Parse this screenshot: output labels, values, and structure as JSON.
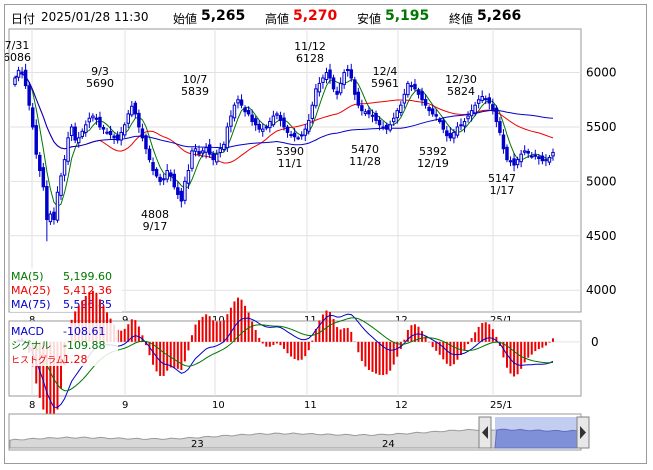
{
  "header": {
    "date_label": "日付",
    "datetime": "2025/01/28 11:30",
    "open_label": "始値",
    "open": "5,265",
    "high_label": "高値",
    "high": "5,270",
    "low_label": "安値",
    "low": "5,195",
    "close_label": "終値",
    "close": "5,266"
  },
  "colors": {
    "up": "#0000cc",
    "down": "#0000cc",
    "ma5": "#007700",
    "ma25": "#ee0000",
    "ma75": "#0000cc",
    "hist_pos": "#ee0000",
    "hist_neg": "#ee0000",
    "high_text": "#ee0000",
    "low_text": "#007700"
  },
  "legend": {
    "ma5_label": "MA(5)",
    "ma5_value": "5,199.60",
    "ma25_label": "MA(25)",
    "ma25_value": "5,412.36",
    "ma75_label": "MA(75)",
    "ma75_value": "5,596.85"
  },
  "macd_legend": {
    "macd_label": "MACD",
    "macd_value": "-108.61",
    "signal_label": "シグナル",
    "signal_value": "-109.88",
    "hist_label": "ヒストグラム",
    "hist_value": "1.28"
  },
  "chart_data": [
    {
      "type": "candlestick",
      "ylim": [
        3800,
        6400
      ],
      "y_ticks": [
        4000,
        4500,
        5000,
        5500,
        6000
      ],
      "x_ticks": [
        "8",
        "9",
        "10",
        "11",
        "12",
        "25/1"
      ],
      "annotations": [
        {
          "value": "7/31",
          "price": "6086"
        },
        {
          "value": "9/3",
          "price": "5690"
        },
        {
          "value": "10/7",
          "price": "5839"
        },
        {
          "value": "11/12",
          "price": "6128"
        },
        {
          "value": "12/4",
          "price": "5961"
        },
        {
          "value": "12/30",
          "price": "5824"
        },
        {
          "price": "4808",
          "value": "9/17"
        },
        {
          "price": "5390",
          "value": "11/1"
        },
        {
          "price": "5470",
          "value": "11/28"
        },
        {
          "price": "5392",
          "value": "12/19"
        },
        {
          "price": "5147",
          "value": "1/17"
        }
      ],
      "close": [
        5950,
        6020,
        6000,
        5880,
        5700,
        5500,
        5250,
        5100,
        4950,
        4650,
        4700,
        4650,
        4900,
        5050,
        5200,
        5400,
        5500,
        5380,
        5400,
        5460,
        5520,
        5580,
        5600,
        5570,
        5500,
        5480,
        5450,
        5430,
        5400,
        5380,
        5450,
        5520,
        5620,
        5690,
        5620,
        5500,
        5400,
        5300,
        5200,
        5100,
        5050,
        5000,
        5020,
        5100,
        5050,
        4950,
        4880,
        4820,
        5000,
        5100,
        5280,
        5300,
        5250,
        5280,
        5310,
        5250,
        5200,
        5250,
        5300,
        5340,
        5500,
        5600,
        5700,
        5750,
        5700,
        5640,
        5620,
        5550,
        5520,
        5480,
        5480,
        5500,
        5550,
        5600,
        5620,
        5560,
        5500,
        5450,
        5430,
        5410,
        5400,
        5420,
        5480,
        5560,
        5700,
        5850,
        5900,
        5950,
        6000,
        5950,
        5850,
        5800,
        5900,
        6000,
        6020,
        5950,
        5800,
        5700,
        5650,
        5640,
        5620,
        5600,
        5560,
        5520,
        5500,
        5480,
        5520,
        5580,
        5650,
        5700,
        5800,
        5900,
        5880,
        5850,
        5800,
        5750,
        5700,
        5650,
        5620,
        5600,
        5550,
        5480,
        5420,
        5400,
        5450,
        5500,
        5520,
        5550,
        5600,
        5650,
        5700,
        5750,
        5780,
        5760,
        5720,
        5650,
        5550,
        5450,
        5300,
        5200,
        5180,
        5150,
        5200,
        5250,
        5280,
        5260,
        5230,
        5240,
        5210,
        5190,
        5200,
        5220,
        5266
      ]
    },
    {
      "type": "line",
      "name": "MACD",
      "ylim": [
        -260,
        100
      ],
      "y_ticks": [
        0
      ],
      "x_ticks": [
        "8",
        "9",
        "10",
        "11",
        "12",
        "25/1"
      ]
    },
    {
      "type": "area",
      "x_ticks": [
        "23",
        "24"
      ]
    }
  ]
}
